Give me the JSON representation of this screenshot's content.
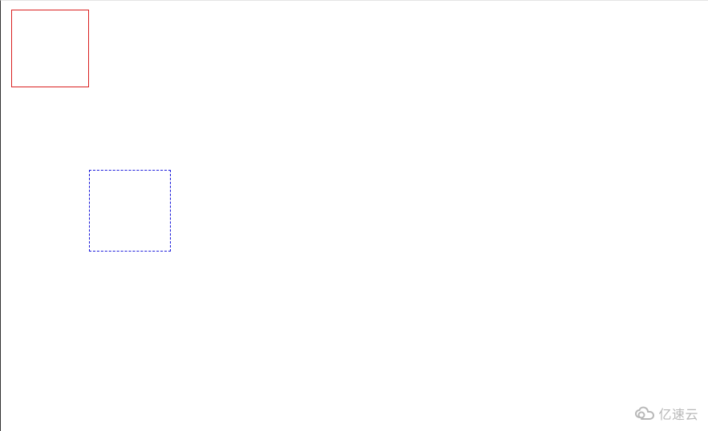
{
  "boxes": {
    "red": {
      "border_color": "#d92020",
      "border_style": "solid"
    },
    "blue": {
      "border_color": "#1a1adb",
      "border_style": "dashed"
    }
  },
  "watermark": {
    "text": "亿速云",
    "icon": "cloud-loop-icon",
    "color": "#b8b8b8"
  }
}
